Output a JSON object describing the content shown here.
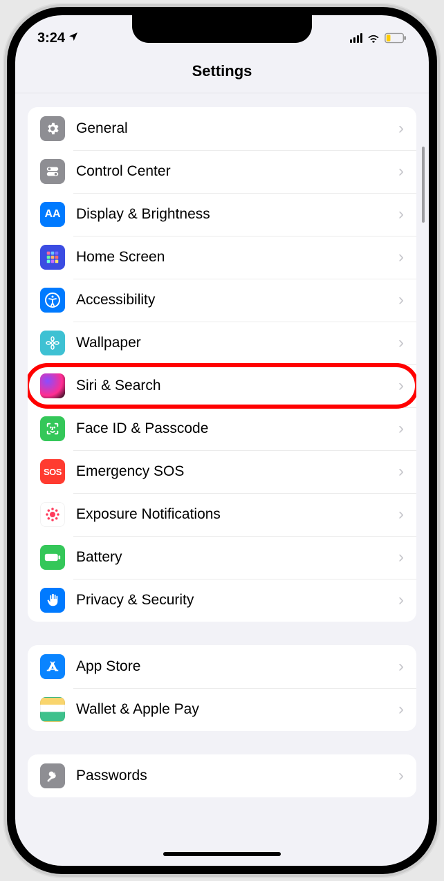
{
  "status": {
    "time": "3:24"
  },
  "header": {
    "title": "Settings"
  },
  "sections": [
    {
      "items": [
        {
          "id": "general",
          "label": "General"
        },
        {
          "id": "control-center",
          "label": "Control Center"
        },
        {
          "id": "display",
          "label": "Display & Brightness"
        },
        {
          "id": "home-screen",
          "label": "Home Screen"
        },
        {
          "id": "accessibility",
          "label": "Accessibility"
        },
        {
          "id": "wallpaper",
          "label": "Wallpaper"
        },
        {
          "id": "siri",
          "label": "Siri & Search",
          "highlighted": true
        },
        {
          "id": "face-id",
          "label": "Face ID & Passcode"
        },
        {
          "id": "sos",
          "label": "Emergency SOS"
        },
        {
          "id": "exposure",
          "label": "Exposure Notifications"
        },
        {
          "id": "battery",
          "label": "Battery"
        },
        {
          "id": "privacy",
          "label": "Privacy & Security"
        }
      ]
    },
    {
      "items": [
        {
          "id": "app-store",
          "label": "App Store"
        },
        {
          "id": "wallet",
          "label": "Wallet & Apple Pay"
        }
      ]
    },
    {
      "items": [
        {
          "id": "passwords",
          "label": "Passwords"
        }
      ]
    }
  ],
  "sos_text": "SOS"
}
